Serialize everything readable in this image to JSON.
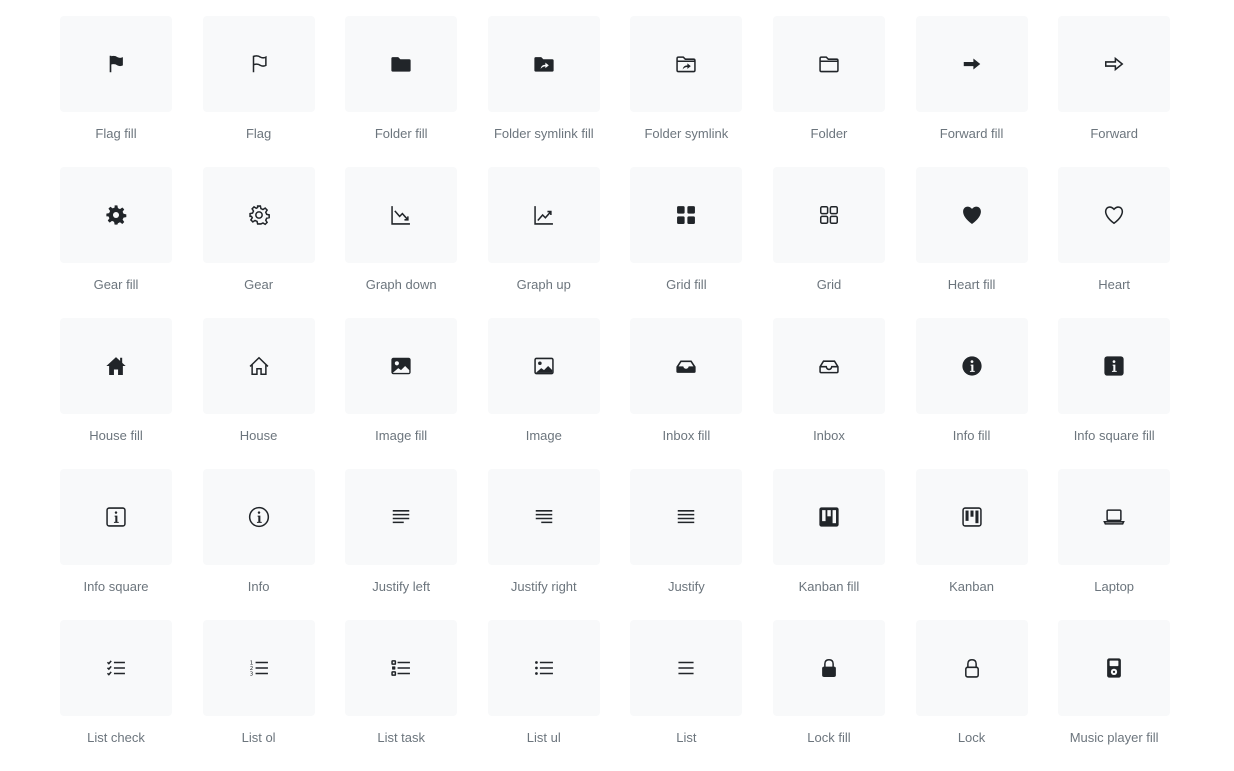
{
  "icon_color": "#212529",
  "label_color": "#6c757d",
  "tile_color": "#f8f9fa",
  "icons": [
    {
      "label": "Flag fill",
      "icon": "flag-fill"
    },
    {
      "label": "Flag",
      "icon": "flag"
    },
    {
      "label": "Folder fill",
      "icon": "folder-fill"
    },
    {
      "label": "Folder symlink fill",
      "icon": "folder-symlink-fill"
    },
    {
      "label": "Folder symlink",
      "icon": "folder-symlink"
    },
    {
      "label": "Folder",
      "icon": "folder"
    },
    {
      "label": "Forward fill",
      "icon": "forward-fill"
    },
    {
      "label": "Forward",
      "icon": "forward"
    },
    {
      "label": "Gear fill",
      "icon": "gear-fill"
    },
    {
      "label": "Gear",
      "icon": "gear"
    },
    {
      "label": "Graph down",
      "icon": "graph-down"
    },
    {
      "label": "Graph up",
      "icon": "graph-up"
    },
    {
      "label": "Grid fill",
      "icon": "grid-fill"
    },
    {
      "label": "Grid",
      "icon": "grid"
    },
    {
      "label": "Heart fill",
      "icon": "heart-fill"
    },
    {
      "label": "Heart",
      "icon": "heart"
    },
    {
      "label": "House fill",
      "icon": "house-fill"
    },
    {
      "label": "House",
      "icon": "house"
    },
    {
      "label": "Image fill",
      "icon": "image-fill"
    },
    {
      "label": "Image",
      "icon": "image"
    },
    {
      "label": "Inbox fill",
      "icon": "inbox-fill"
    },
    {
      "label": "Inbox",
      "icon": "inbox"
    },
    {
      "label": "Info fill",
      "icon": "info-fill"
    },
    {
      "label": "Info square fill",
      "icon": "info-square-fill"
    },
    {
      "label": "Info square",
      "icon": "info-square"
    },
    {
      "label": "Info",
      "icon": "info"
    },
    {
      "label": "Justify left",
      "icon": "justify-left"
    },
    {
      "label": "Justify right",
      "icon": "justify-right"
    },
    {
      "label": "Justify",
      "icon": "justify"
    },
    {
      "label": "Kanban fill",
      "icon": "kanban-fill"
    },
    {
      "label": "Kanban",
      "icon": "kanban"
    },
    {
      "label": "Laptop",
      "icon": "laptop"
    },
    {
      "label": "List check",
      "icon": "list-check"
    },
    {
      "label": "List ol",
      "icon": "list-ol"
    },
    {
      "label": "List task",
      "icon": "list-task"
    },
    {
      "label": "List ul",
      "icon": "list-ul"
    },
    {
      "label": "List",
      "icon": "list"
    },
    {
      "label": "Lock fill",
      "icon": "lock-fill"
    },
    {
      "label": "Lock",
      "icon": "lock"
    },
    {
      "label": "Music player fill",
      "icon": "music-player-fill"
    }
  ]
}
